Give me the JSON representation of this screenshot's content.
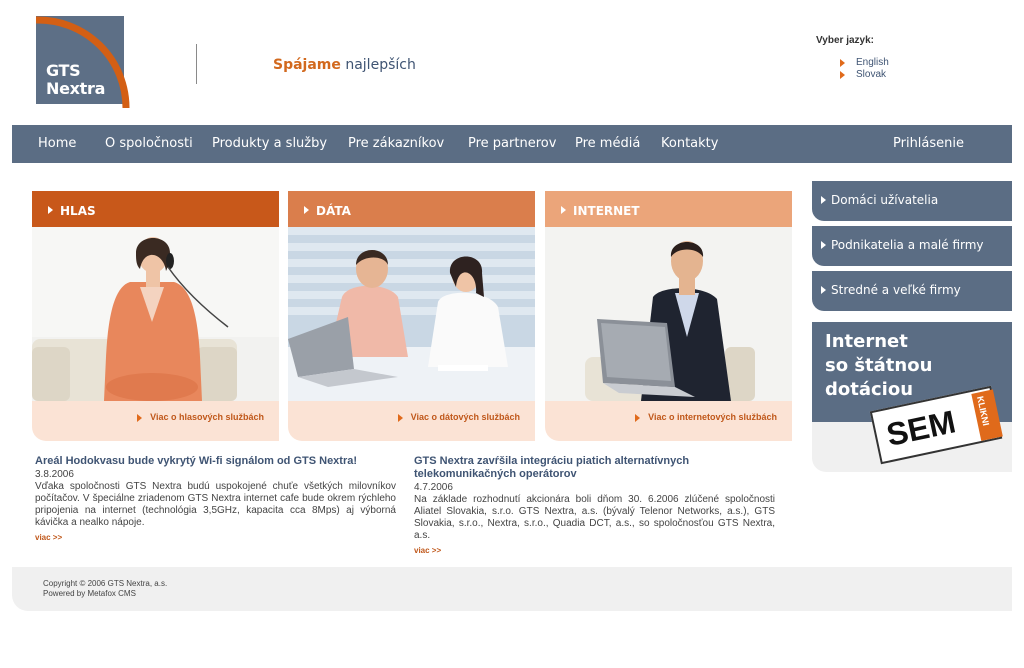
{
  "logo": {
    "line1": "GTS",
    "line2": "Nextra"
  },
  "slogan": {
    "part1": "Spájame",
    "part2": "najlepších"
  },
  "language": {
    "title": "Vyber jazyk:",
    "options": [
      "English",
      "Slovak"
    ]
  },
  "nav": {
    "items": [
      "Home",
      "O spoločnosti",
      "Produkty a služby",
      "Pre zákazníkov",
      "Pre partnerov",
      "Pre médiá",
      "Kontakty"
    ],
    "login": "Prihlásenie"
  },
  "services": [
    {
      "title": "HLAS",
      "more": "Viac o hlasových službách"
    },
    {
      "title": "DÁTA",
      "more": "Viac o dátových službách"
    },
    {
      "title": "INTERNET",
      "more": "Viac o internetových službách"
    }
  ],
  "sidebar": {
    "items": [
      "Domáci užívatelia",
      "Podnikatelia a malé firmy",
      "Stredné a veľké firmy"
    ]
  },
  "promo": {
    "line1": "Internet",
    "line2": "so štátnou",
    "line3": "dotáciou",
    "button": "SEM",
    "button_tag": "KLIKNI"
  },
  "news": [
    {
      "title": "Areál Hodokvasu bude vykrytý Wi-fi signálom od GTS Nextra!",
      "date": "3.8.2006",
      "body": "Vďaka spoločnosti GTS Nextra budú uspokojené chuťe všetkých milovníkov počítačov. V špeciálne zriadenom GTS Nextra internet cafe bude okrem rýchleho pripojenia na internet (technológia 3,5GHz, kapacita cca 8Mps) aj výborná kávička a nealko nápoje.",
      "more": "viac >>"
    },
    {
      "title": "GTS Nextra zavŕšila integráciu piatich alternatívnych telekomunikačných operátorov",
      "date": "4.7.2006",
      "body": "Na základe rozhodnutí akcionára boli dňom 30. 6.2006 zlúčené spoločnosti Aliatel Slovakia, s.r.o. GTS Nextra, a.s. (bývalý Telenor Networks, a.s.), GTS Slovakia, s.r.o., Nextra, s.r.o., Quadia DCT, a.s., so spoločnosťou GTS Nextra, a.s.",
      "more": "viac >>"
    }
  ],
  "footer": {
    "copyright": "Copyright © 2006 GTS Nextra, a.s.",
    "powered": "Powered by Metafox CMS"
  },
  "colors": {
    "nav": "#5b6d84",
    "accent_orange": "#e06a1b",
    "hlas": "#c8581a",
    "data": "#da7e4c",
    "internet": "#eba57a",
    "box_bg": "#fbe3d5",
    "footer": "#f0f0f0"
  }
}
